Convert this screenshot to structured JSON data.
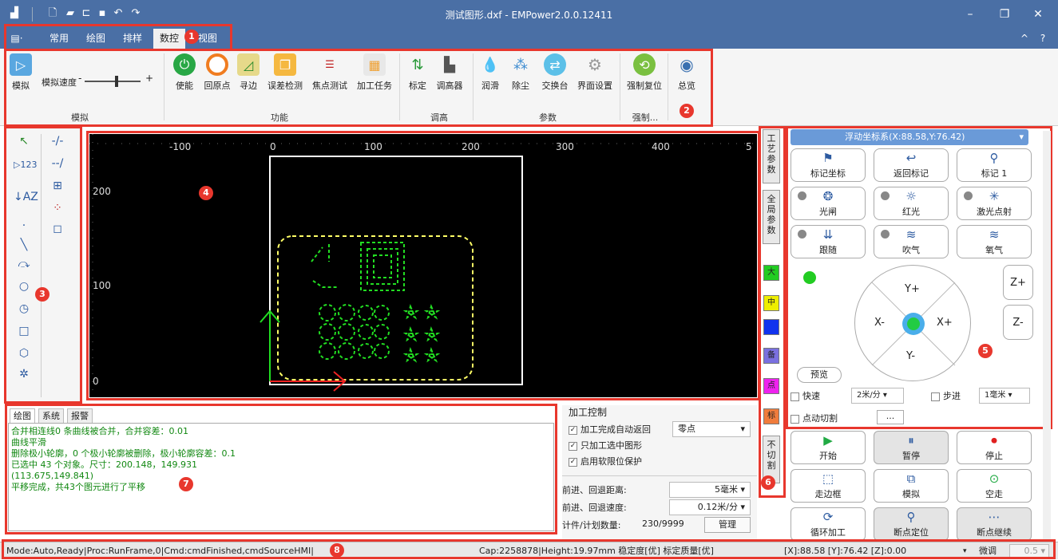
{
  "window": {
    "title": "测试图形.dxf - EMPower2.0.0.12411"
  },
  "menu": [
    "常用",
    "绘图",
    "排样",
    "数控",
    "视图"
  ],
  "ribbon": {
    "sim_label": "模拟",
    "speed_label": "模拟速度",
    "function_buttons": [
      "使能",
      "回原点",
      "寻边",
      "误差检测",
      "焦点测试",
      "加工任务"
    ],
    "adjust_buttons": [
      "标定",
      "调高器"
    ],
    "param_buttons": [
      "润滑",
      "除尘",
      "交换台",
      "界面设置"
    ],
    "force_button": "强制复位",
    "overview_button": "总览",
    "groups": [
      "模拟",
      "功能",
      "调高",
      "参数",
      "强制..."
    ]
  },
  "canvas": {
    "x_ticks": [
      "-100",
      "0",
      "100",
      "200",
      "300",
      "400",
      "5"
    ],
    "y_ticks": [
      "200",
      "100",
      "0"
    ]
  },
  "log": {
    "tabs": [
      "绘图",
      "系统",
      "报警"
    ],
    "lines": [
      "合并相连线0 条曲线被合并，合并容差：0.01",
      "曲线平滑",
      "删除极小轮廓，0 个极小轮廓被删除，极小轮廓容差：0.1",
      "已选中 43 个对象。尺寸：200.148，149.931",
      "(113.675,149.841)",
      "平移完成，共43个图元进行了平移"
    ]
  },
  "process": {
    "title": "加工控制",
    "opt1": "加工完成自动返回",
    "opt1_value": "零点",
    "opt2": "只加工选中图形",
    "opt3": "启用软限位保护",
    "dist_label": "前进、回退距离:",
    "dist_value": "5毫米",
    "speed_label": "前进、回退速度:",
    "speed_value": "0.12米/分",
    "count_label": "计件/计划数量:",
    "count_value": "230/9999",
    "manage": "管理"
  },
  "vtabs": {
    "craft": "工艺参数",
    "global": "全局参数",
    "nocut": "不切割"
  },
  "colors": [
    {
      "label": "大",
      "color": "#22cc22"
    },
    {
      "label": "中",
      "color": "#eeee00"
    },
    {
      "label": "",
      "color": "#1133ee"
    },
    {
      "label": "备",
      "color": "#7a70e0"
    },
    {
      "label": "点",
      "color": "#ee22ee"
    },
    {
      "label": "标",
      "color": "#f07c3c"
    }
  ],
  "control": {
    "coord_title": "浮动坐标系(X:88.58,Y:76.42)",
    "row1": [
      "标记坐标",
      "返回标记",
      "标记 1"
    ],
    "row2": [
      "光闸",
      "红光",
      "激光点射"
    ],
    "row3": [
      "跟随",
      "吹气",
      "氧气"
    ],
    "jog": {
      "yp": "Y+",
      "ym": "Y-",
      "xm": "X-",
      "xp": "X+",
      "zp": "Z+",
      "zm": "Z-"
    },
    "preview": "预览",
    "fast": "快速",
    "fast_value": "2米/分",
    "step": "步进",
    "step_value": "1毫米",
    "jogcut": "点动切割",
    "more": "..."
  },
  "actions": [
    "开始",
    "暂停",
    "停止",
    "走边框",
    "模拟",
    "空走",
    "循环加工",
    "断点定位",
    "断点继续"
  ],
  "status": {
    "left": "Mode:Auto,Ready|Proc:RunFrame,0|Cmd:cmdFinished,cmdSourceHMI|",
    "mid": "Cap:2258878|Height:19.97mm 稳定度[优] 标定质量[优]",
    "coords": "[X]:88.58  [Y]:76.42  [Z]:0.00",
    "fine": "微调",
    "fine_value": "0.5"
  },
  "badges": [
    "1",
    "2",
    "3",
    "4",
    "5",
    "6",
    "7",
    "8"
  ]
}
